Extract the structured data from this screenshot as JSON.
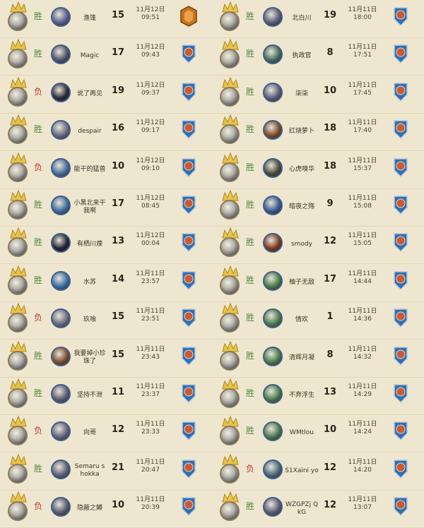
{
  "colors": {
    "win": "#4b8a3a",
    "loss": "#c0392b",
    "background": "#efe6cf",
    "rank_badge_blue": "#2f6fb3",
    "legend_badge_orange": "#c8731f"
  },
  "left_matches": [
    {
      "result": "胜",
      "opponent": "渔篷",
      "opp_color": "#5b5f8a",
      "turns": "15",
      "date": "11月12日",
      "time": "09:51",
      "rank_icon": "legend-hexagon-icon"
    },
    {
      "result": "胜",
      "opponent": "Magic",
      "opp_color": "#4f5266",
      "turns": "17",
      "date": "11月12日",
      "time": "09:43",
      "rank_icon": "rank-badge-icon"
    },
    {
      "result": "负",
      "opponent": "说了再见",
      "opp_color": "#2a2a36",
      "turns": "19",
      "date": "11月12日",
      "time": "09:37",
      "rank_icon": "rank-badge-icon"
    },
    {
      "result": "胜",
      "opponent": "despair",
      "opp_color": "#6a6c80",
      "turns": "16",
      "date": "11月12日",
      "time": "09:17",
      "rank_icon": "rank-badge-icon"
    },
    {
      "result": "负",
      "opponent": "能干的猛兽",
      "opp_color": "#476c9a",
      "turns": "10",
      "date": "11月12日",
      "time": "09:10",
      "rank_icon": "rank-badge-icon"
    },
    {
      "result": "胜",
      "opponent": "小黑北来干我啊",
      "opp_color": "#3f6b9a",
      "turns": "17",
      "date": "11月12日",
      "time": "08:45",
      "rank_icon": "rank-badge-icon"
    },
    {
      "result": "胜",
      "opponent": "有栖川煉",
      "opp_color": "#1f2230",
      "turns": "13",
      "date": "11月12日",
      "time": "00:04",
      "rank_icon": "rank-badge-icon"
    },
    {
      "result": "胜",
      "opponent": "水苏",
      "opp_color": "#3a6ea0",
      "turns": "14",
      "date": "11月11日",
      "time": "23:57",
      "rank_icon": "rank-badge-icon"
    },
    {
      "result": "负",
      "opponent": "玖喰",
      "opp_color": "#6a6c7e",
      "turns": "15",
      "date": "11月11日",
      "time": "23:51",
      "rank_icon": "rank-badge-icon"
    },
    {
      "result": "胜",
      "opponent": "我要掉小珍珠了",
      "opp_color": "#7a4a2a",
      "turns": "15",
      "date": "11月11日",
      "time": "23:43",
      "rank_icon": "rank-badge-icon"
    },
    {
      "result": "胜",
      "opponent": "坚持不泄",
      "opp_color": "#5a5c72",
      "turns": "11",
      "date": "11月11日",
      "time": "23:37",
      "rank_icon": "rank-badge-icon"
    },
    {
      "result": "负",
      "opponent": "向哥",
      "opp_color": "#62647a",
      "turns": "12",
      "date": "11月11日",
      "time": "23:33",
      "rank_icon": "rank-badge-icon"
    },
    {
      "result": "胜",
      "opponent": "Semaru shokka",
      "opp_color": "#5e6076",
      "turns": "21",
      "date": "11月11日",
      "time": "20:47",
      "rank_icon": "rank-badge-icon"
    },
    {
      "result": "负",
      "opponent": "隐蔽之鳟",
      "opp_color": "#585a70",
      "turns": "10",
      "date": "11月11日",
      "time": "20:39",
      "rank_icon": "rank-badge-icon"
    }
  ],
  "right_matches": [
    {
      "result": "胜",
      "opponent": "北白川",
      "opp_color": "#5a5c74",
      "turns": "19",
      "date": "11月11日",
      "time": "18:00",
      "rank_icon": "rank-badge-icon"
    },
    {
      "result": "胜",
      "opponent": "执政官",
      "opp_color": "#4a6a5a",
      "turns": "8",
      "date": "11月11日",
      "time": "17:51",
      "rank_icon": "rank-badge-icon"
    },
    {
      "result": "胜",
      "opponent": "柒柒",
      "opp_color": "#5c5e76",
      "turns": "10",
      "date": "11月11日",
      "time": "17:45",
      "rank_icon": "rank-badge-icon"
    },
    {
      "result": "胜",
      "opponent": "红烧萝卜",
      "opp_color": "#7a4a26",
      "turns": "18",
      "date": "11月11日",
      "time": "17:40",
      "rank_icon": "rank-badge-icon"
    },
    {
      "result": "胜",
      "opponent": "心虎嗅华",
      "opp_color": "#4a4a3a",
      "turns": "18",
      "date": "11月11日",
      "time": "15:37",
      "rank_icon": "rank-badge-icon"
    },
    {
      "result": "胜",
      "opponent": "暗夜之殇",
      "opp_color": "#3a5a8a",
      "turns": "9",
      "date": "11月11日",
      "time": "15:08",
      "rank_icon": "rank-badge-icon"
    },
    {
      "result": "胜",
      "opponent": "smody",
      "opp_color": "#7a3a1a",
      "turns": "12",
      "date": "11月11日",
      "time": "15:05",
      "rank_icon": "rank-badge-icon"
    },
    {
      "result": "胜",
      "opponent": "柚子无敌",
      "opp_color": "#4a7a4a",
      "turns": "17",
      "date": "11月11日",
      "time": "14:44",
      "rank_icon": "rank-badge-icon"
    },
    {
      "result": "胜",
      "opponent": "情欢",
      "opp_color": "#4e7a4e",
      "turns": "1",
      "date": "11月11日",
      "time": "14:36",
      "rank_icon": "rank-badge-icon"
    },
    {
      "result": "胜",
      "opponent": "清辉月凝",
      "opp_color": "#4a7a4a",
      "turns": "8",
      "date": "11月11日",
      "time": "14:32",
      "rank_icon": "rank-badge-icon"
    },
    {
      "result": "胜",
      "opponent": "不弃浮生",
      "opp_color": "#4a7a4a",
      "turns": "13",
      "date": "11月11日",
      "time": "14:29",
      "rank_icon": "rank-badge-icon"
    },
    {
      "result": "胜",
      "opponent": "WMtlou",
      "opp_color": "#4a7a4a",
      "turns": "10",
      "date": "11月11日",
      "time": "14:24",
      "rank_icon": "rank-badge-icon"
    },
    {
      "result": "负",
      "opponent": "S1Xaini yo",
      "opp_color": "#4a6a7a",
      "turns": "12",
      "date": "11月11日",
      "time": "14:20",
      "rank_icon": "rank-badge-icon"
    },
    {
      "result": "胜",
      "opponent": "WZGPZj QkG",
      "opp_color": "#5a5c72",
      "turns": "12",
      "date": "11月11日",
      "time": "13:07",
      "rank_icon": "rank-badge-icon"
    }
  ]
}
